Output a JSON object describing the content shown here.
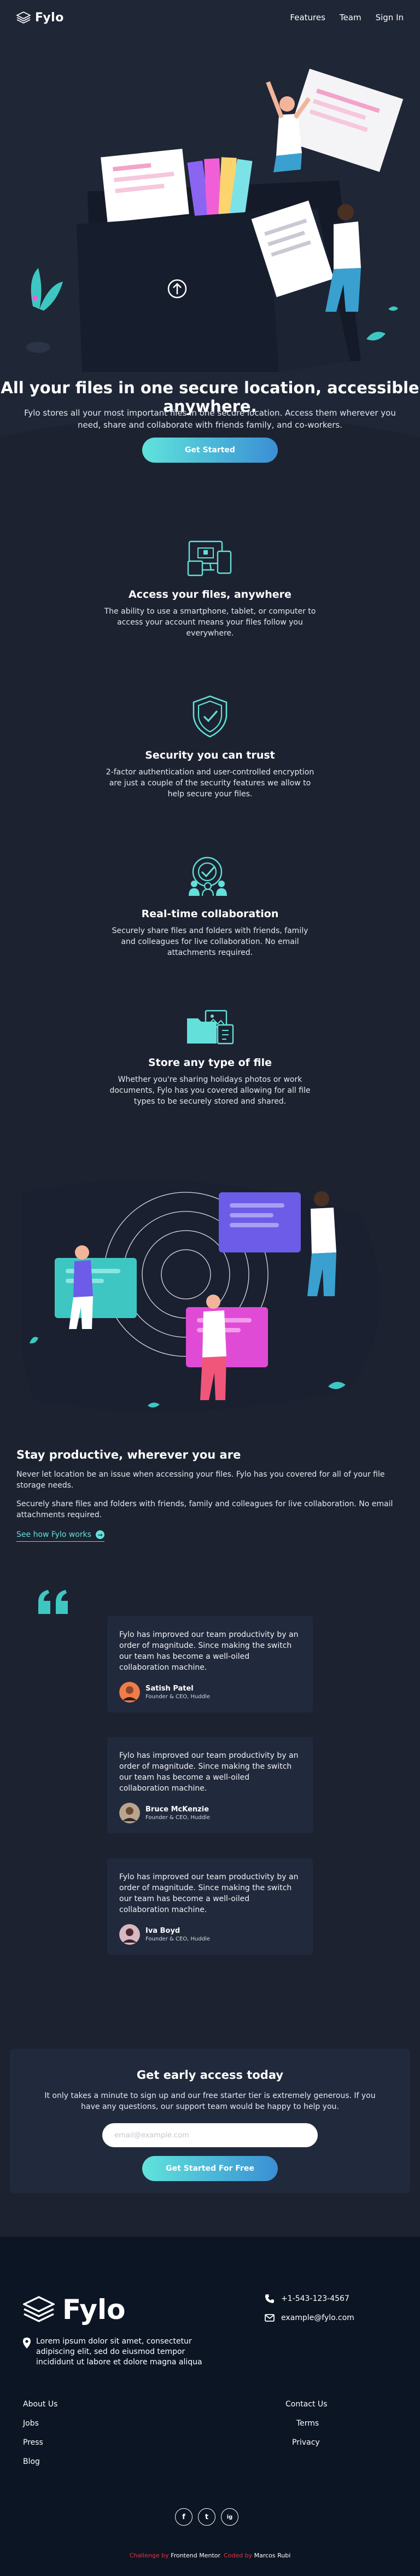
{
  "header": {
    "logo_text": "Fylo",
    "nav": [
      "Features",
      "Team",
      "Sign In"
    ]
  },
  "hero": {
    "title": "All your files in one secure location, accessible anywhere.",
    "text": "Fylo stores all your most important files in one secure location. Access them wherever you need, share and collaborate with friends family, and co-workers.",
    "cta": "Get Started"
  },
  "features": [
    {
      "icon": "devices-icon",
      "title": "Access your files, anywhere",
      "text": "The ability to use a smartphone, tablet, or computer to access your account means your files follow you everywhere."
    },
    {
      "icon": "shield-icon",
      "title": "Security you can trust",
      "text": "2-factor authentication and user-controlled encryption are just a couple of the security features we allow to help secure your files."
    },
    {
      "icon": "collaboration-icon",
      "title": "Real-time collaboration",
      "text": "Securely share files and folders with friends, family and colleagues for live collaboration. No email attachments required."
    },
    {
      "icon": "files-icon",
      "title": "Store any type of file",
      "text": "Whether you're sharing holidays photos or work documents, Fylo has you covered allowing for all file types to be securely stored and shared."
    }
  ],
  "productive": {
    "title": "Stay productive, wherever you are",
    "p1": "Never let location be an issue when accessing your files. Fylo has you covered for all of your file storage needs.",
    "p2": "Securely share files and folders with friends, family and colleagues for live collaboration. No email attachments required.",
    "link": "See how Fylo works",
    "link_arrow": "→"
  },
  "testimonials": [
    {
      "text": "Fylo has improved our team productivity by an order of magnitude. Since making the switch our team has become a well-oiled collaboration machine.",
      "name": "Satish Patel",
      "title": "Founder & CEO, Huddle"
    },
    {
      "text": "Fylo has improved our team productivity by an order of magnitude. Since making the switch our team has become a well-oiled collaboration machine.",
      "name": "Bruce McKenzie",
      "title": "Founder & CEO, Huddle"
    },
    {
      "text": "Fylo has improved our team productivity by an order of magnitude. Since making the switch our team has become a well-oiled collaboration machine.",
      "name": "Iva Boyd",
      "title": "Founder & CEO, Huddle"
    }
  ],
  "early_access": {
    "title": "Get early access today",
    "text": "It only takes a minute to sign up and our free starter tier is extremely generous. If you have any questions, our support team would be happy to help you.",
    "email_placeholder": "email@example.com",
    "cta": "Get Started For Free"
  },
  "footer": {
    "logo_text": "Fylo",
    "location": "Lorem ipsum dolor sit amet, consectetur adipiscing elit, sed do eiusmod tempor incididunt ut labore et dolore magna aliqua",
    "phone": "+1-543-123-4567",
    "email": "example@fylo.com",
    "links_col1": [
      "About Us",
      "Jobs",
      "Press",
      "Blog"
    ],
    "links_col2": [
      "Contact Us",
      "Terms",
      "Privacy"
    ],
    "socials": [
      "f",
      "t",
      "ig"
    ],
    "credit": {
      "prefix": "Challenge by",
      "org": "Frontend Mentor",
      "mid": ". Coded by",
      "author": "Marcos Rubi"
    }
  },
  "colors": {
    "background": "#1c2230",
    "hero": "#1f2636",
    "card": "#21293c",
    "footer": "#0c1524",
    "accent": "#62e0d9",
    "gradient_end": "#3a8fd4"
  }
}
